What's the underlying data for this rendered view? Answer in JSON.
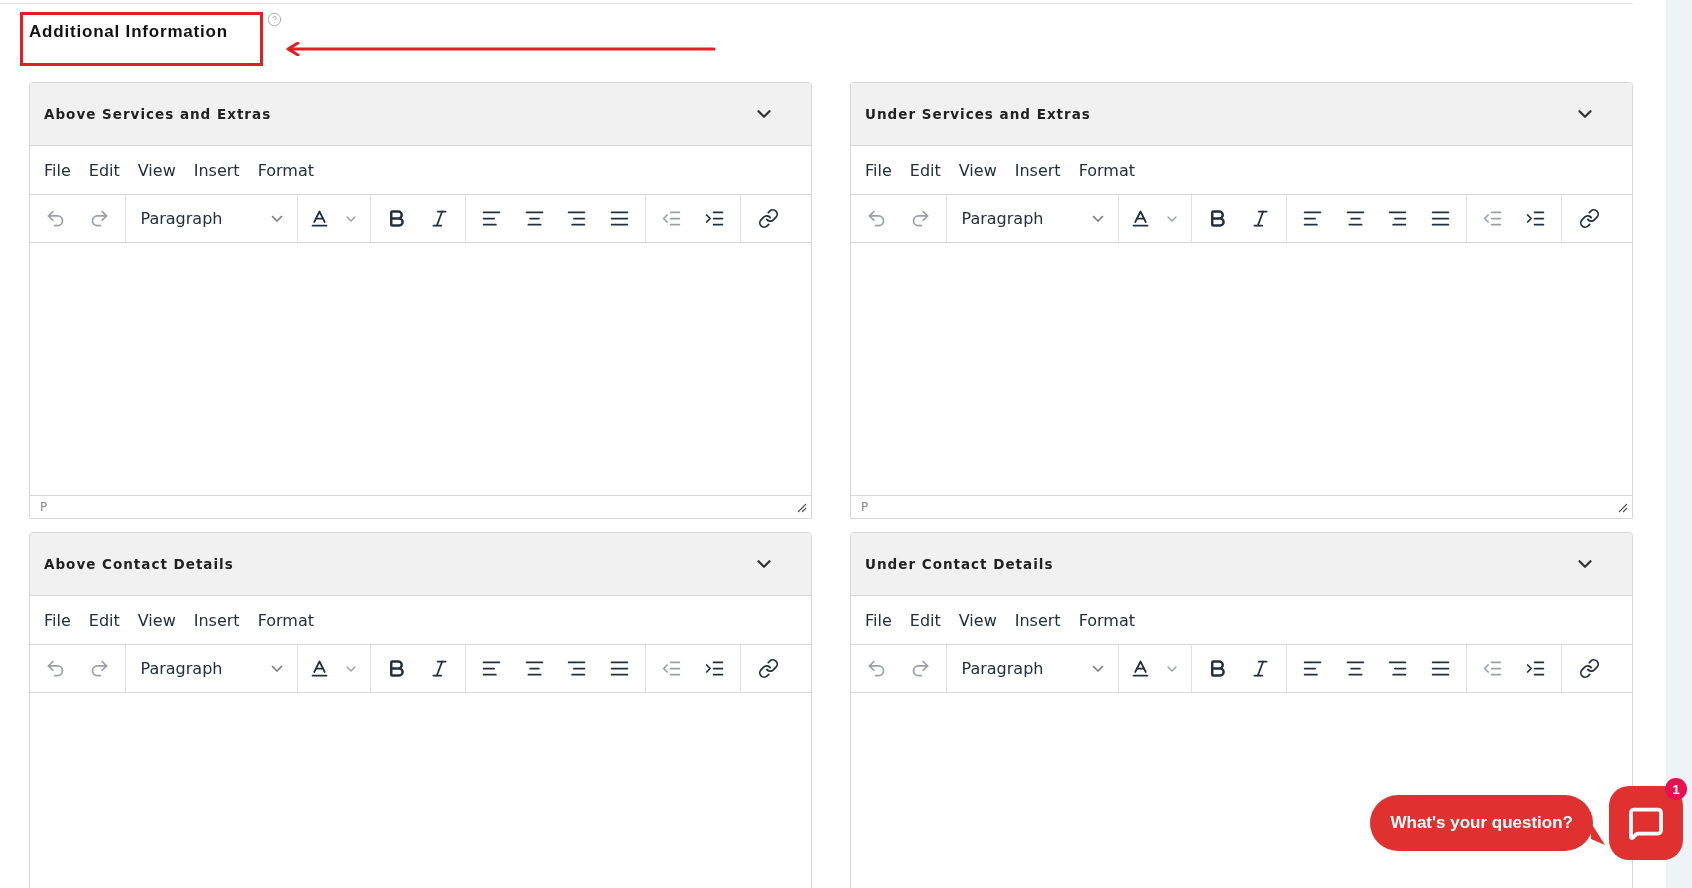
{
  "heading": {
    "title": "Additional Information"
  },
  "editors": [
    {
      "title": "Above Services and Extras",
      "menu": [
        "File",
        "Edit",
        "View",
        "Insert",
        "Format"
      ],
      "block_format": "Paragraph",
      "status_path": "P"
    },
    {
      "title": "Under Services and Extras",
      "menu": [
        "File",
        "Edit",
        "View",
        "Insert",
        "Format"
      ],
      "block_format": "Paragraph",
      "status_path": "P"
    },
    {
      "title": "Above Contact Details",
      "menu": [
        "File",
        "Edit",
        "View",
        "Insert",
        "Format"
      ],
      "block_format": "Paragraph"
    },
    {
      "title": "Under Contact Details",
      "menu": [
        "File",
        "Edit",
        "View",
        "Insert",
        "Format"
      ],
      "block_format": "Paragraph"
    }
  ],
  "chat": {
    "prompt": "What's your question?",
    "badge": "1"
  }
}
